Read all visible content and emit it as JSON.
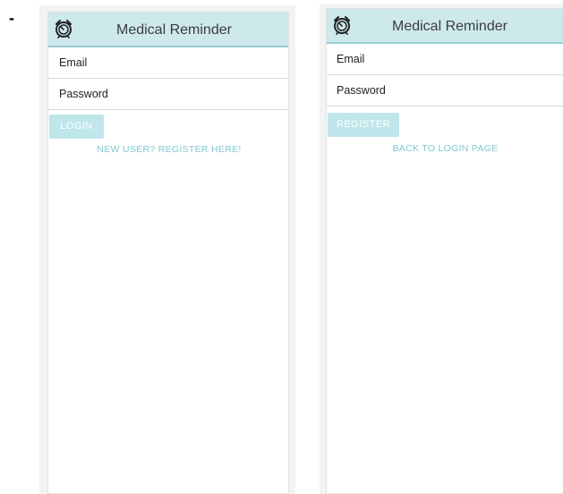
{
  "annotation": {
    "dash": "-"
  },
  "screens": {
    "login": {
      "app_title": "Medical Reminder",
      "email_placeholder": "Email",
      "password_placeholder": "Password",
      "primary_button": "LOGIN",
      "secondary_link": "NEW USER? REGISTER HERE!"
    },
    "register": {
      "app_title": "Medical Reminder",
      "email_placeholder": "Email",
      "password_placeholder": "Password",
      "primary_button": "REGISTER",
      "secondary_link": "BACK TO LOGIN PAGE"
    }
  },
  "colors": {
    "appbar_bg": "#cde9ec",
    "appbar_border": "#9ccbd0",
    "button_bg": "#bfe6ea",
    "link_text": "#7fc8cf",
    "frame_bg": "#f3f3f3"
  },
  "icons": {
    "app_logo": "alarm-clock-icon"
  }
}
